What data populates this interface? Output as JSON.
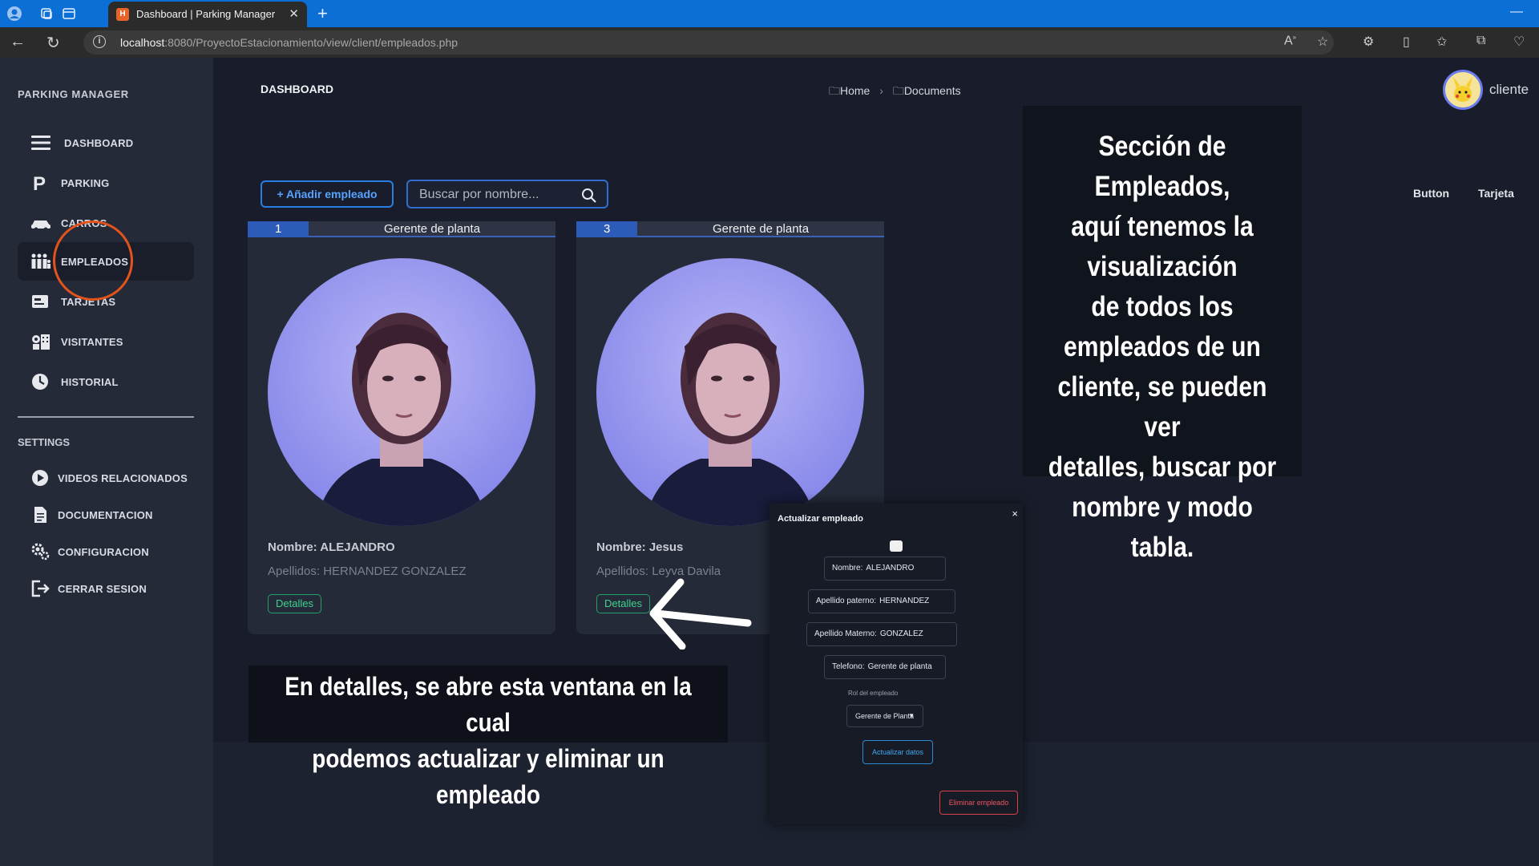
{
  "browser": {
    "tab_title": "Dashboard | Parking Manager",
    "url_host": "localhost",
    "url_path": ":8080/ProyectoEstacionamiento/view/client/empleados.php"
  },
  "sidebar": {
    "brand": "PARKING MANAGER",
    "items": [
      {
        "label": "DASHBOARD",
        "icon": "hamburger-icon"
      },
      {
        "label": "PARKING",
        "icon": "parking-icon"
      },
      {
        "label": "CARROS",
        "icon": "car-icon"
      },
      {
        "label": "EMPLEADOS",
        "icon": "people-icon",
        "active": true
      },
      {
        "label": "TARJETAS",
        "icon": "card-icon"
      },
      {
        "label": "VISITANTES",
        "icon": "visitor-icon"
      },
      {
        "label": "HISTORIAL",
        "icon": "history-icon"
      }
    ],
    "settings_title": "SETTINGS",
    "settings": [
      {
        "label": "VIDEOS RELACIONADOS",
        "icon": "play-icon"
      },
      {
        "label": "DOCUMENTACION",
        "icon": "document-icon"
      },
      {
        "label": "CONFIGURACION",
        "icon": "gear-icon"
      },
      {
        "label": "CERRAR SESION",
        "icon": "logout-icon"
      }
    ]
  },
  "header": {
    "title": "DASHBOARD",
    "breadcrumb": [
      "Home",
      "Documents"
    ],
    "user": "cliente"
  },
  "toolbar": {
    "add_label": "+ Añadir empleado",
    "search_placeholder": "Buscar por nombre...",
    "view_buttons": [
      "Button",
      "Tarjeta"
    ]
  },
  "employees": [
    {
      "id": "1",
      "role": "Gerente de planta",
      "name": "Nombre: ALEJANDRO",
      "lastname": "Apellidos: HERNANDEZ GONZALEZ",
      "detail": "Detalles"
    },
    {
      "id": "3",
      "role": "Gerente de planta",
      "name": "Nombre: Jesus",
      "lastname": "Apellidos: Leyva Davila",
      "detail": "Detalles"
    }
  ],
  "modal": {
    "title": "Actualizar empleado",
    "close": "×",
    "fields": [
      {
        "label": "Nombre:",
        "value": "ALEJANDRO"
      },
      {
        "label": "Apellido paterno:",
        "value": "HERNANDEZ"
      },
      {
        "label": "Apellido Materno:",
        "value": "GONZALEZ"
      },
      {
        "label": "Telefono:",
        "value": "Gerente de planta"
      }
    ],
    "role_label": "Rol del empleado",
    "role_value": "Gerente de Planta",
    "update_label": "Actualizar datos",
    "delete_label": "Eliminar empleado"
  },
  "annotations": {
    "top": "Sección de Empleados,\naquí tenemos la\nvisualización\nde todos los\nempleados de un\ncliente, se pueden ver\ndetalles, buscar por\nnombre y modo tabla.",
    "bottom": "En detalles, se abre esta ventana en la cual\npodemos actualizar y eliminar un empleado"
  },
  "colors": {
    "accent": "#2a7de1",
    "highlight": "#e2541c",
    "danger": "#d8404a",
    "success": "#23a06a"
  }
}
